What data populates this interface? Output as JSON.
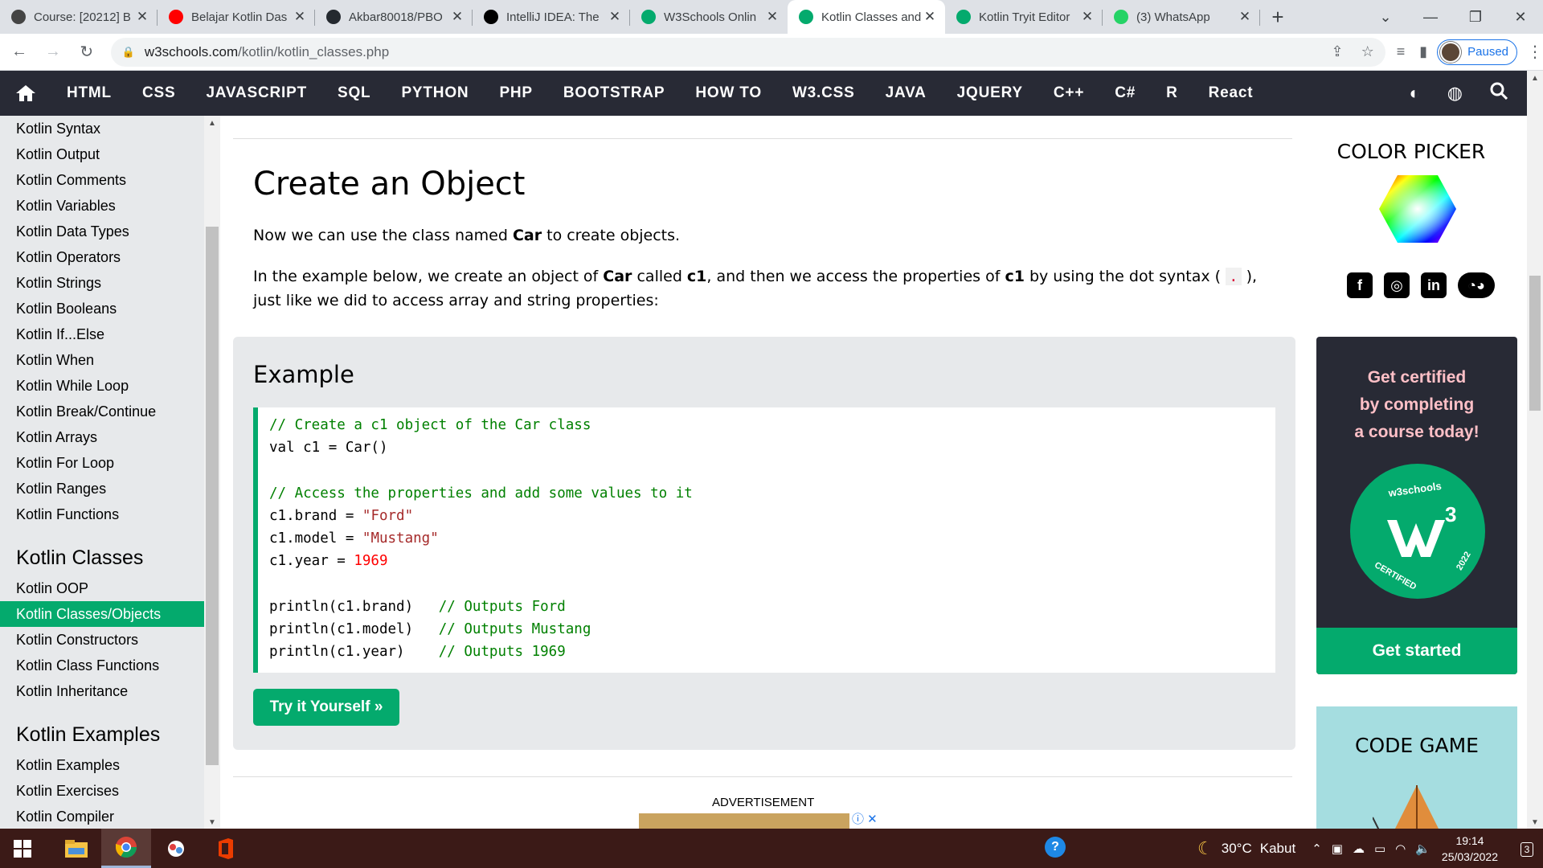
{
  "browser": {
    "tabs": [
      {
        "title": "Course: [20212] B",
        "favicon_color": "#444444"
      },
      {
        "title": "Belajar Kotlin Das",
        "favicon_color": "#ff0000"
      },
      {
        "title": "Akbar80018/PBO",
        "favicon_color": "#24292f"
      },
      {
        "title": "IntelliJ IDEA: The",
        "favicon_color": "#000000"
      },
      {
        "title": "W3Schools Onlin",
        "favicon_color": "#04aa6d"
      },
      {
        "title": "Kotlin Classes and",
        "favicon_color": "#04aa6d"
      },
      {
        "title": "Kotlin Tryit Editor",
        "favicon_color": "#04aa6d"
      },
      {
        "title": "(3) WhatsApp",
        "favicon_color": "#25d366"
      }
    ],
    "url_host": "w3schools.com",
    "url_path": "/kotlin/kotlin_classes.php",
    "profile_status": "Paused"
  },
  "nav": {
    "items": [
      "HTML",
      "CSS",
      "JAVASCRIPT",
      "SQL",
      "PYTHON",
      "PHP",
      "BOOTSTRAP",
      "HOW TO",
      "W3.CSS",
      "JAVA",
      "JQUERY",
      "C++",
      "C#",
      "R",
      "React"
    ]
  },
  "sidebar": {
    "group1": [
      "Kotlin Syntax",
      "Kotlin Output",
      "Kotlin Comments",
      "Kotlin Variables",
      "Kotlin Data Types",
      "Kotlin Operators",
      "Kotlin Strings",
      "Kotlin Booleans",
      "Kotlin If...Else",
      "Kotlin When",
      "Kotlin While Loop",
      "Kotlin Break/Continue",
      "Kotlin Arrays",
      "Kotlin For Loop",
      "Kotlin Ranges",
      "Kotlin Functions"
    ],
    "heading2": "Kotlin Classes",
    "group2": [
      "Kotlin OOP",
      "Kotlin Classes/Objects",
      "Kotlin Constructors",
      "Kotlin Class Functions",
      "Kotlin Inheritance"
    ],
    "active_item": "Kotlin Classes/Objects",
    "heading3": "Kotlin Examples",
    "group3": [
      "Kotlin Examples",
      "Kotlin Exercises",
      "Kotlin Compiler"
    ]
  },
  "main": {
    "title": "Create an Object",
    "p1": {
      "before": "Now we can use the class named ",
      "bold": "Car",
      "after": " to create objects."
    },
    "p2": {
      "t1": "In the example below, we create an object of ",
      "b1": "Car",
      "t2": " called ",
      "b2": "c1",
      "t3": ", and then we access the properties of ",
      "b3": "c1",
      "t4": " by using the dot syntax ( ",
      "code": ".",
      "t5": " ),",
      "line2": "just like we did to access array and string properties:"
    },
    "example_heading": "Example",
    "code_lines": [
      {
        "c": "// Create a c1 object of the Car class"
      },
      {
        "t": "val c1 = Car()"
      },
      {
        "t": ""
      },
      {
        "c": "// Access the properties and add some values to it"
      },
      {
        "t": "c1.brand = ",
        "s": "\"Ford\""
      },
      {
        "t": "c1.model = ",
        "s": "\"Mustang\""
      },
      {
        "t": "c1.year = ",
        "n": "1969"
      },
      {
        "t": ""
      },
      {
        "t": "println(c1.brand)   ",
        "c": "// Outputs Ford"
      },
      {
        "t": "println(c1.model)   ",
        "c": "// Outputs Mustang"
      },
      {
        "t": "println(c1.year)    ",
        "c": "// Outputs 1969"
      }
    ],
    "tryit_label": "Try it Yourself »",
    "advertisement_label": "ADVERTISEMENT"
  },
  "right": {
    "color_picker_title": "COLOR PICKER",
    "social": [
      "facebook-icon",
      "instagram-icon",
      "linkedin-icon",
      "discord-icon"
    ],
    "cert_lines": [
      "Get certified",
      "by completing",
      "a course today!"
    ],
    "cert_badge_top": "w3schools",
    "cert_badge_bottom": "CERTIFIED",
    "cert_badge_year": "2022",
    "cert_button": "Get started",
    "code_game_title": "CODE GAME"
  },
  "taskbar": {
    "weather_temp": "30°C",
    "weather_desc": "Kabut",
    "time": "19:14",
    "date": "25/03/2022",
    "notif_count": "3"
  }
}
